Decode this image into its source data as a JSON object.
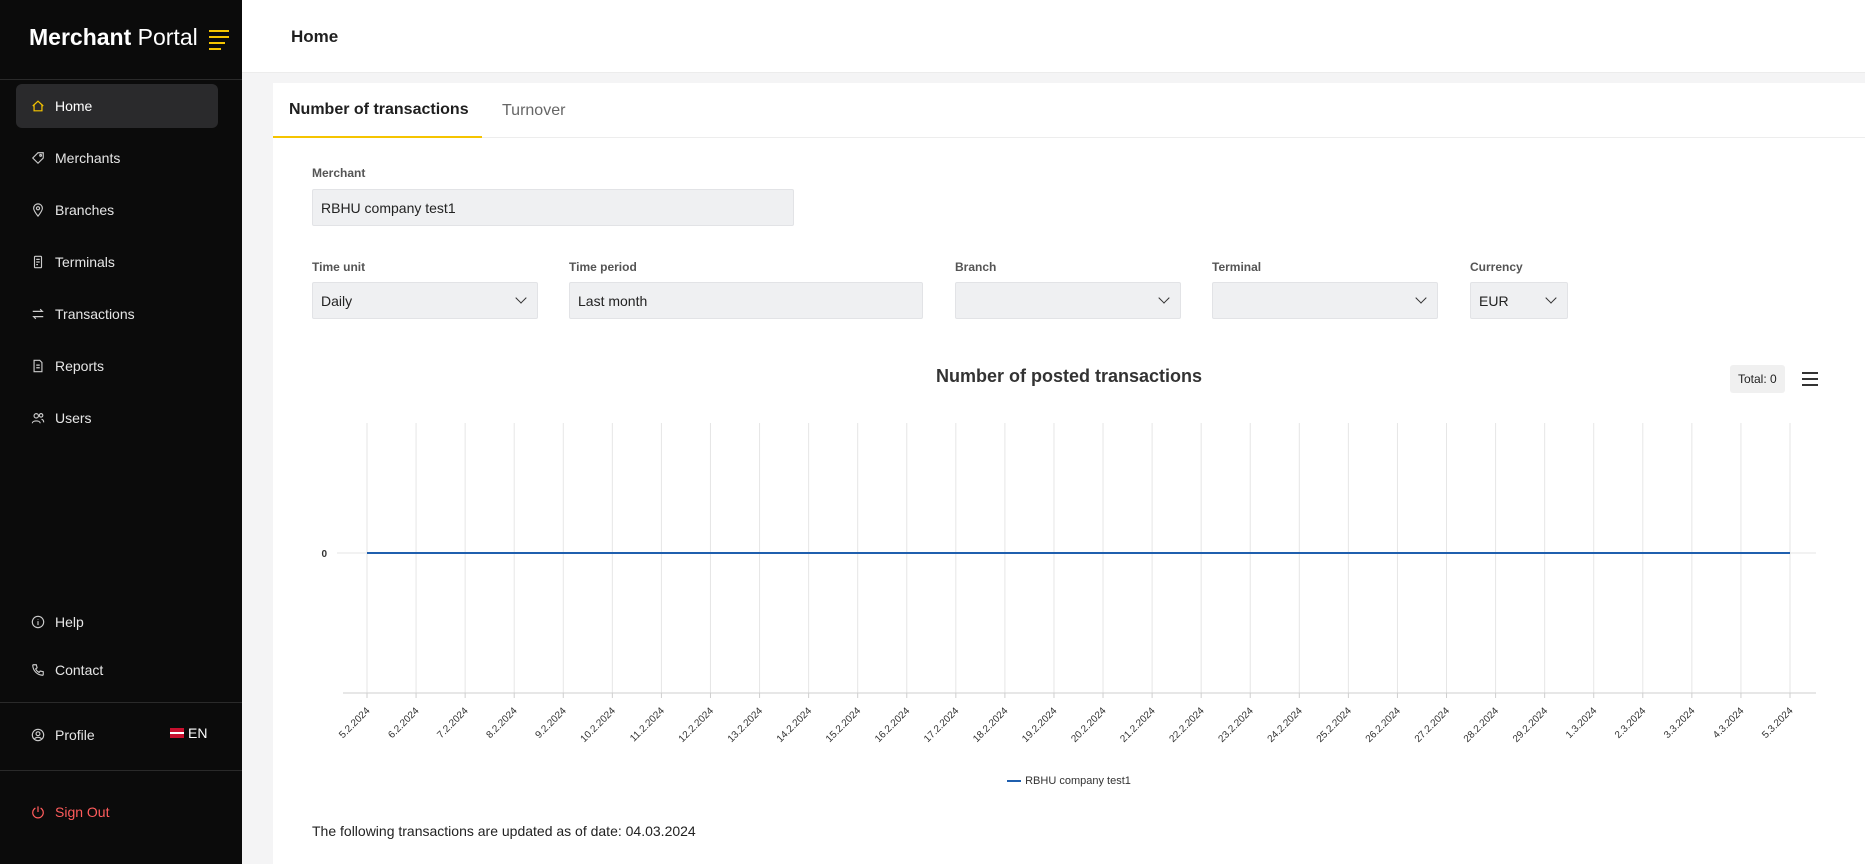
{
  "app": {
    "brand_bold": "Merchant",
    "brand_light": " Portal"
  },
  "sidebar": {
    "items": [
      {
        "label": "Home",
        "icon": "home-icon",
        "active": true
      },
      {
        "label": "Merchants",
        "icon": "tag-icon"
      },
      {
        "label": "Branches",
        "icon": "location-pin-icon"
      },
      {
        "label": "Terminals",
        "icon": "terminal-icon"
      },
      {
        "label": "Transactions",
        "icon": "transfer-icon"
      },
      {
        "label": "Reports",
        "icon": "document-icon"
      },
      {
        "label": "Users",
        "icon": "users-icon"
      }
    ],
    "bottom": [
      {
        "label": "Help",
        "icon": "info-icon"
      },
      {
        "label": "Contact",
        "icon": "phone-icon"
      }
    ],
    "profile_label": "Profile",
    "language": "EN",
    "signout_label": "Sign Out"
  },
  "header": {
    "title": "Home"
  },
  "tabs": [
    {
      "label": "Number of transactions",
      "active": true
    },
    {
      "label": "Turnover",
      "active": false
    }
  ],
  "filters": {
    "merchant": {
      "label": "Merchant",
      "value": "RBHU company test1"
    },
    "time_unit": {
      "label": "Time unit",
      "value": "Daily"
    },
    "time_period": {
      "label": "Time period",
      "value": "Last month"
    },
    "branch": {
      "label": "Branch",
      "value": ""
    },
    "terminal": {
      "label": "Terminal",
      "value": ""
    },
    "currency": {
      "label": "Currency",
      "value": "EUR"
    }
  },
  "chart_data": {
    "type": "line",
    "title": "Number of posted transactions",
    "total_label": "Total: 0",
    "categories": [
      "5.2.2024",
      "6.2.2024",
      "7.2.2024",
      "8.2.2024",
      "9.2.2024",
      "10.2.2024",
      "11.2.2024",
      "12.2.2024",
      "13.2.2024",
      "14.2.2024",
      "15.2.2024",
      "16.2.2024",
      "17.2.2024",
      "18.2.2024",
      "19.2.2024",
      "20.2.2024",
      "21.2.2024",
      "22.2.2024",
      "23.2.2024",
      "24.2.2024",
      "25.2.2024",
      "26.2.2024",
      "27.2.2024",
      "28.2.2024",
      "29.2.2024",
      "1.3.2024",
      "2.3.2024",
      "3.3.2024",
      "4.3.2024",
      "5.3.2024"
    ],
    "series": [
      {
        "name": "RBHU company test1",
        "values": [
          0,
          0,
          0,
          0,
          0,
          0,
          0,
          0,
          0,
          0,
          0,
          0,
          0,
          0,
          0,
          0,
          0,
          0,
          0,
          0,
          0,
          0,
          0,
          0,
          0,
          0,
          0,
          0,
          0,
          0
        ]
      }
    ],
    "y_ticks": [
      "0"
    ],
    "series_color": "#1f5fae",
    "grid": true,
    "legend": "bottom-center"
  },
  "footnote": "The following transactions are updated as of date: 04.03.2024"
}
